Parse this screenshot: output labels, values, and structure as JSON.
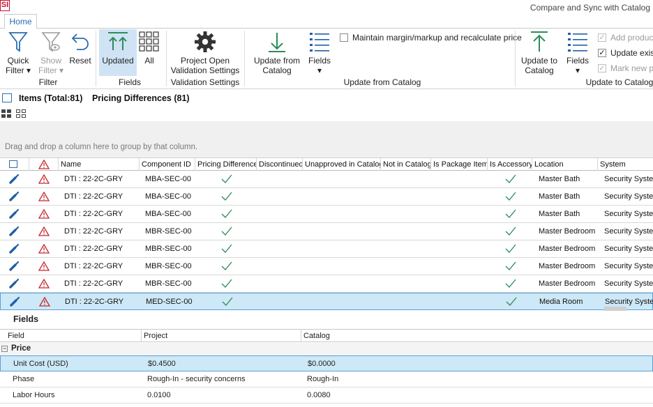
{
  "app": {
    "logo_text": "SI",
    "window_title": "Compare and Sync with Catalog"
  },
  "ribbon": {
    "tab": "Home",
    "buttons": {
      "quick_filter": "Quick\nFilter ▾",
      "show_filter": "Show\nFilter ▾",
      "reset": "Reset",
      "updated": "Updated",
      "all": "All",
      "project_open": "Project Open\nValidation Settings",
      "update_from_catalog": "Update from\nCatalog",
      "fields_1": "Fields\n▾",
      "update_to_catalog": "Update to\nCatalog",
      "fields_2": "Fields\n▾"
    },
    "groups": {
      "filter": "Filter",
      "fields": "Fields",
      "validation": "Validation Settings",
      "update_from": "Update from Catalog",
      "update_to": "Update to Catalog"
    },
    "checkboxes": {
      "maintain_margin": {
        "label": "Maintain margin/markup and recalculate price",
        "checked": false
      },
      "add_products": {
        "label": "Add product",
        "checked": true
      },
      "update_existing": {
        "label": "Update exist",
        "checked": true
      },
      "mark_new": {
        "label": "Mark new pr",
        "checked": true
      }
    }
  },
  "summary": {
    "items": "Items (Total:81)",
    "pricing": "Pricing Differences (81)"
  },
  "grid": {
    "group_hint": "Drag and drop a column here to group by that column.",
    "columns": [
      "Name",
      "Component ID",
      "Pricing Difference",
      "Discontinued",
      "Unapproved in Catalog",
      "Not in Catalog",
      "Is Package Item",
      "Is Accessory",
      "Location",
      "System"
    ],
    "rows": [
      {
        "name": "DTI : 22-2C-GRY",
        "component_id": "MBA-SEC-00",
        "location": "Master Bath",
        "system": "Security System"
      },
      {
        "name": "DTI : 22-2C-GRY",
        "component_id": "MBA-SEC-00",
        "location": "Master Bath",
        "system": "Security System"
      },
      {
        "name": "DTI : 22-2C-GRY",
        "component_id": "MBA-SEC-00",
        "location": "Master Bath",
        "system": "Security System"
      },
      {
        "name": "DTI : 22-2C-GRY",
        "component_id": "MBR-SEC-00",
        "location": "Master Bedroom",
        "system": "Security System"
      },
      {
        "name": "DTI : 22-2C-GRY",
        "component_id": "MBR-SEC-00",
        "location": "Master Bedroom",
        "system": "Security System"
      },
      {
        "name": "DTI : 22-2C-GRY",
        "component_id": "MBR-SEC-00",
        "location": "Master Bedroom",
        "system": "Security System"
      },
      {
        "name": "DTI : 22-2C-GRY",
        "component_id": "MBR-SEC-00",
        "location": "Master Bedroom",
        "system": "Security System"
      },
      {
        "name": "DTI : 22-2C-GRY",
        "component_id": "MED-SEC-00",
        "location": "Media Room",
        "system": "Security System"
      }
    ]
  },
  "fields_panel": {
    "title": "Fields",
    "columns": [
      "Field",
      "Project",
      "Catalog"
    ],
    "group": "Price",
    "rows": [
      {
        "field": "Unit Cost (USD)",
        "project": "$0.4500",
        "catalog": "$0.0000"
      },
      {
        "field": "Phase",
        "project": "Rough-In - security concerns",
        "catalog": "Rough-In"
      },
      {
        "field": "Labor Hours",
        "project": "0.0100",
        "catalog": "0.0080"
      }
    ]
  },
  "colors": {
    "accent_blue": "#2b6cb0",
    "check_green": "#2e8b57",
    "warning_red": "#c62828",
    "tool_blue": "#1f5fa8"
  }
}
